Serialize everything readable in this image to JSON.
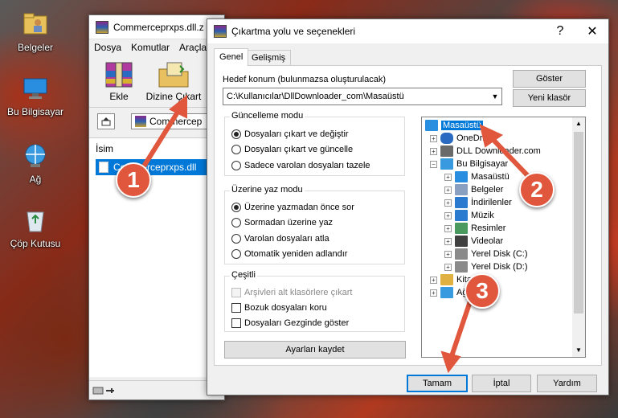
{
  "desktop": {
    "icons": [
      {
        "label": "Belgeler",
        "icon": "folder-user-icon"
      },
      {
        "label": "Bu Bilgisayar",
        "icon": "computer-icon"
      },
      {
        "label": "Ağ",
        "icon": "network-icon"
      },
      {
        "label": "Çöp Kutusu",
        "icon": "recycle-bin-icon"
      }
    ]
  },
  "winrar": {
    "title": "Commerceprxps.dll.z",
    "menu": [
      "Dosya",
      "Komutlar",
      "Araçla"
    ],
    "toolbar": {
      "add": "Ekle",
      "extract": "Dizine Çıkart"
    },
    "path": "Commercep",
    "column_name": "İsim",
    "file": "Commerceprxps.dll"
  },
  "dialog": {
    "title": "Çıkartma yolu ve seçenekleri",
    "help": "?",
    "close": "✕",
    "tabs": [
      "Genel",
      "Gelişmiş"
    ],
    "dest_label": "Hedef konum (bulunmazsa oluşturulacak)",
    "dest_value": "C:\\Kullanıcılar\\DllDownloader_com\\Masaüstü",
    "show_btn": "Göster",
    "new_folder_btn": "Yeni klasör",
    "update_group": {
      "title": "Güncelleme modu",
      "options": [
        "Dosyaları çıkart ve değiştir",
        "Dosyaları çıkart ve güncelle",
        "Sadece varolan dosyaları tazele"
      ],
      "selected": 0
    },
    "overwrite_group": {
      "title": "Üzerine yaz modu",
      "options": [
        "Üzerine yazmadan önce sor",
        "Sormadan üzerine yaz",
        "Varolan dosyaları atla",
        "Otomatik yeniden adlandır"
      ],
      "selected": 0
    },
    "misc_group": {
      "title": "Çeşitli",
      "options": [
        "Arşivleri alt klasörlere çıkart",
        "Bozuk dosyaları koru",
        "Dosyaları Gezginde göster"
      ]
    },
    "save_btn": "Ayarları kaydet",
    "tree": [
      {
        "label": "Masaüstü",
        "level": 0,
        "icon": "desktop-icon",
        "selected": true
      },
      {
        "label": "OneDrive",
        "level": 1,
        "icon": "cloud-icon"
      },
      {
        "label": "DLL Downloader.com",
        "level": 1,
        "icon": "user-icon"
      },
      {
        "label": "Bu Bilgisayar",
        "level": 1,
        "icon": "computer-icon",
        "expanded": true
      },
      {
        "label": "Masaüstü",
        "level": 2,
        "icon": "desktop-icon"
      },
      {
        "label": "Belgeler",
        "level": 2,
        "icon": "documents-icon"
      },
      {
        "label": "İndirilenler",
        "level": 2,
        "icon": "download-icon"
      },
      {
        "label": "Müzik",
        "level": 2,
        "icon": "music-icon"
      },
      {
        "label": "Resimler",
        "level": 2,
        "icon": "pictures-icon"
      },
      {
        "label": "Videolar",
        "level": 2,
        "icon": "videos-icon"
      },
      {
        "label": "Yerel Disk (C:)",
        "level": 2,
        "icon": "drive-icon"
      },
      {
        "label": "Yerel Disk (D:)",
        "level": 2,
        "icon": "drive-icon"
      },
      {
        "label": "Kitapl",
        "level": 1,
        "icon": "library-icon"
      },
      {
        "label": "Ağ",
        "level": 1,
        "icon": "network-icon"
      }
    ],
    "ok_btn": "Tamam",
    "cancel_btn": "İptal",
    "help_btn": "Yardım"
  },
  "callouts": [
    "1",
    "2",
    "3"
  ],
  "colors": {
    "callout": "#e0573d",
    "selection": "#0078d7"
  }
}
